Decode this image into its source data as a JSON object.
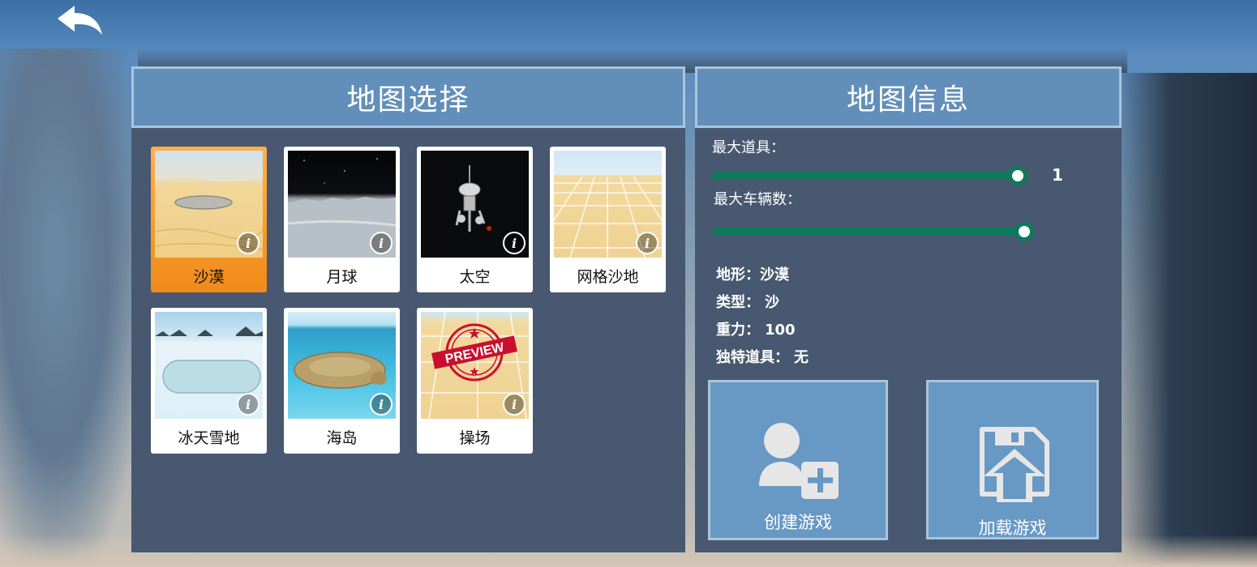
{
  "left_panel": {
    "title": "地图选择",
    "maps": [
      {
        "label": "沙漠",
        "selected": true,
        "thumb": "desert-track"
      },
      {
        "label": "月球",
        "selected": false,
        "thumb": "moon-surface"
      },
      {
        "label": "太空",
        "selected": false,
        "thumb": "space-station"
      },
      {
        "label": "网格沙地",
        "selected": false,
        "thumb": "grid-sand"
      },
      {
        "label": "冰天雪地",
        "selected": false,
        "thumb": "snow-field"
      },
      {
        "label": "海岛",
        "selected": false,
        "thumb": "turtle-island"
      },
      {
        "label": "操场",
        "selected": false,
        "thumb": "playground-preview"
      }
    ],
    "preview_stamp": "PREVIEW",
    "info_glyph": "i"
  },
  "right_panel": {
    "title": "地图信息",
    "max_items": {
      "label": "最大道具：",
      "value_text": "1",
      "value_fraction": 1.0
    },
    "max_vehicles": {
      "label": "最大车辆数：",
      "value_text": "",
      "value_fraction": 1.0
    },
    "stats": [
      {
        "label": "地形：",
        "value": "沙漠"
      },
      {
        "label": "类型：",
        "value": "沙"
      },
      {
        "label": "重力：",
        "value": "100"
      },
      {
        "label": "独特道具：",
        "value": "无"
      }
    ],
    "create_button": {
      "label": "创建游戏",
      "icon": "add-user-icon"
    },
    "load_button": {
      "label": "加载游戏",
      "icon": "load-save-icon"
    }
  },
  "colors": {
    "panel_bg": "#475870",
    "header_bg": "#628fba",
    "header_border": "#a9c5de",
    "selected_card": "#f08a1a",
    "slider_track": "#0e7a5c",
    "button_bg": "#6898c4"
  },
  "icons": {
    "back": "back-arrow-icon",
    "info": "info-icon"
  }
}
